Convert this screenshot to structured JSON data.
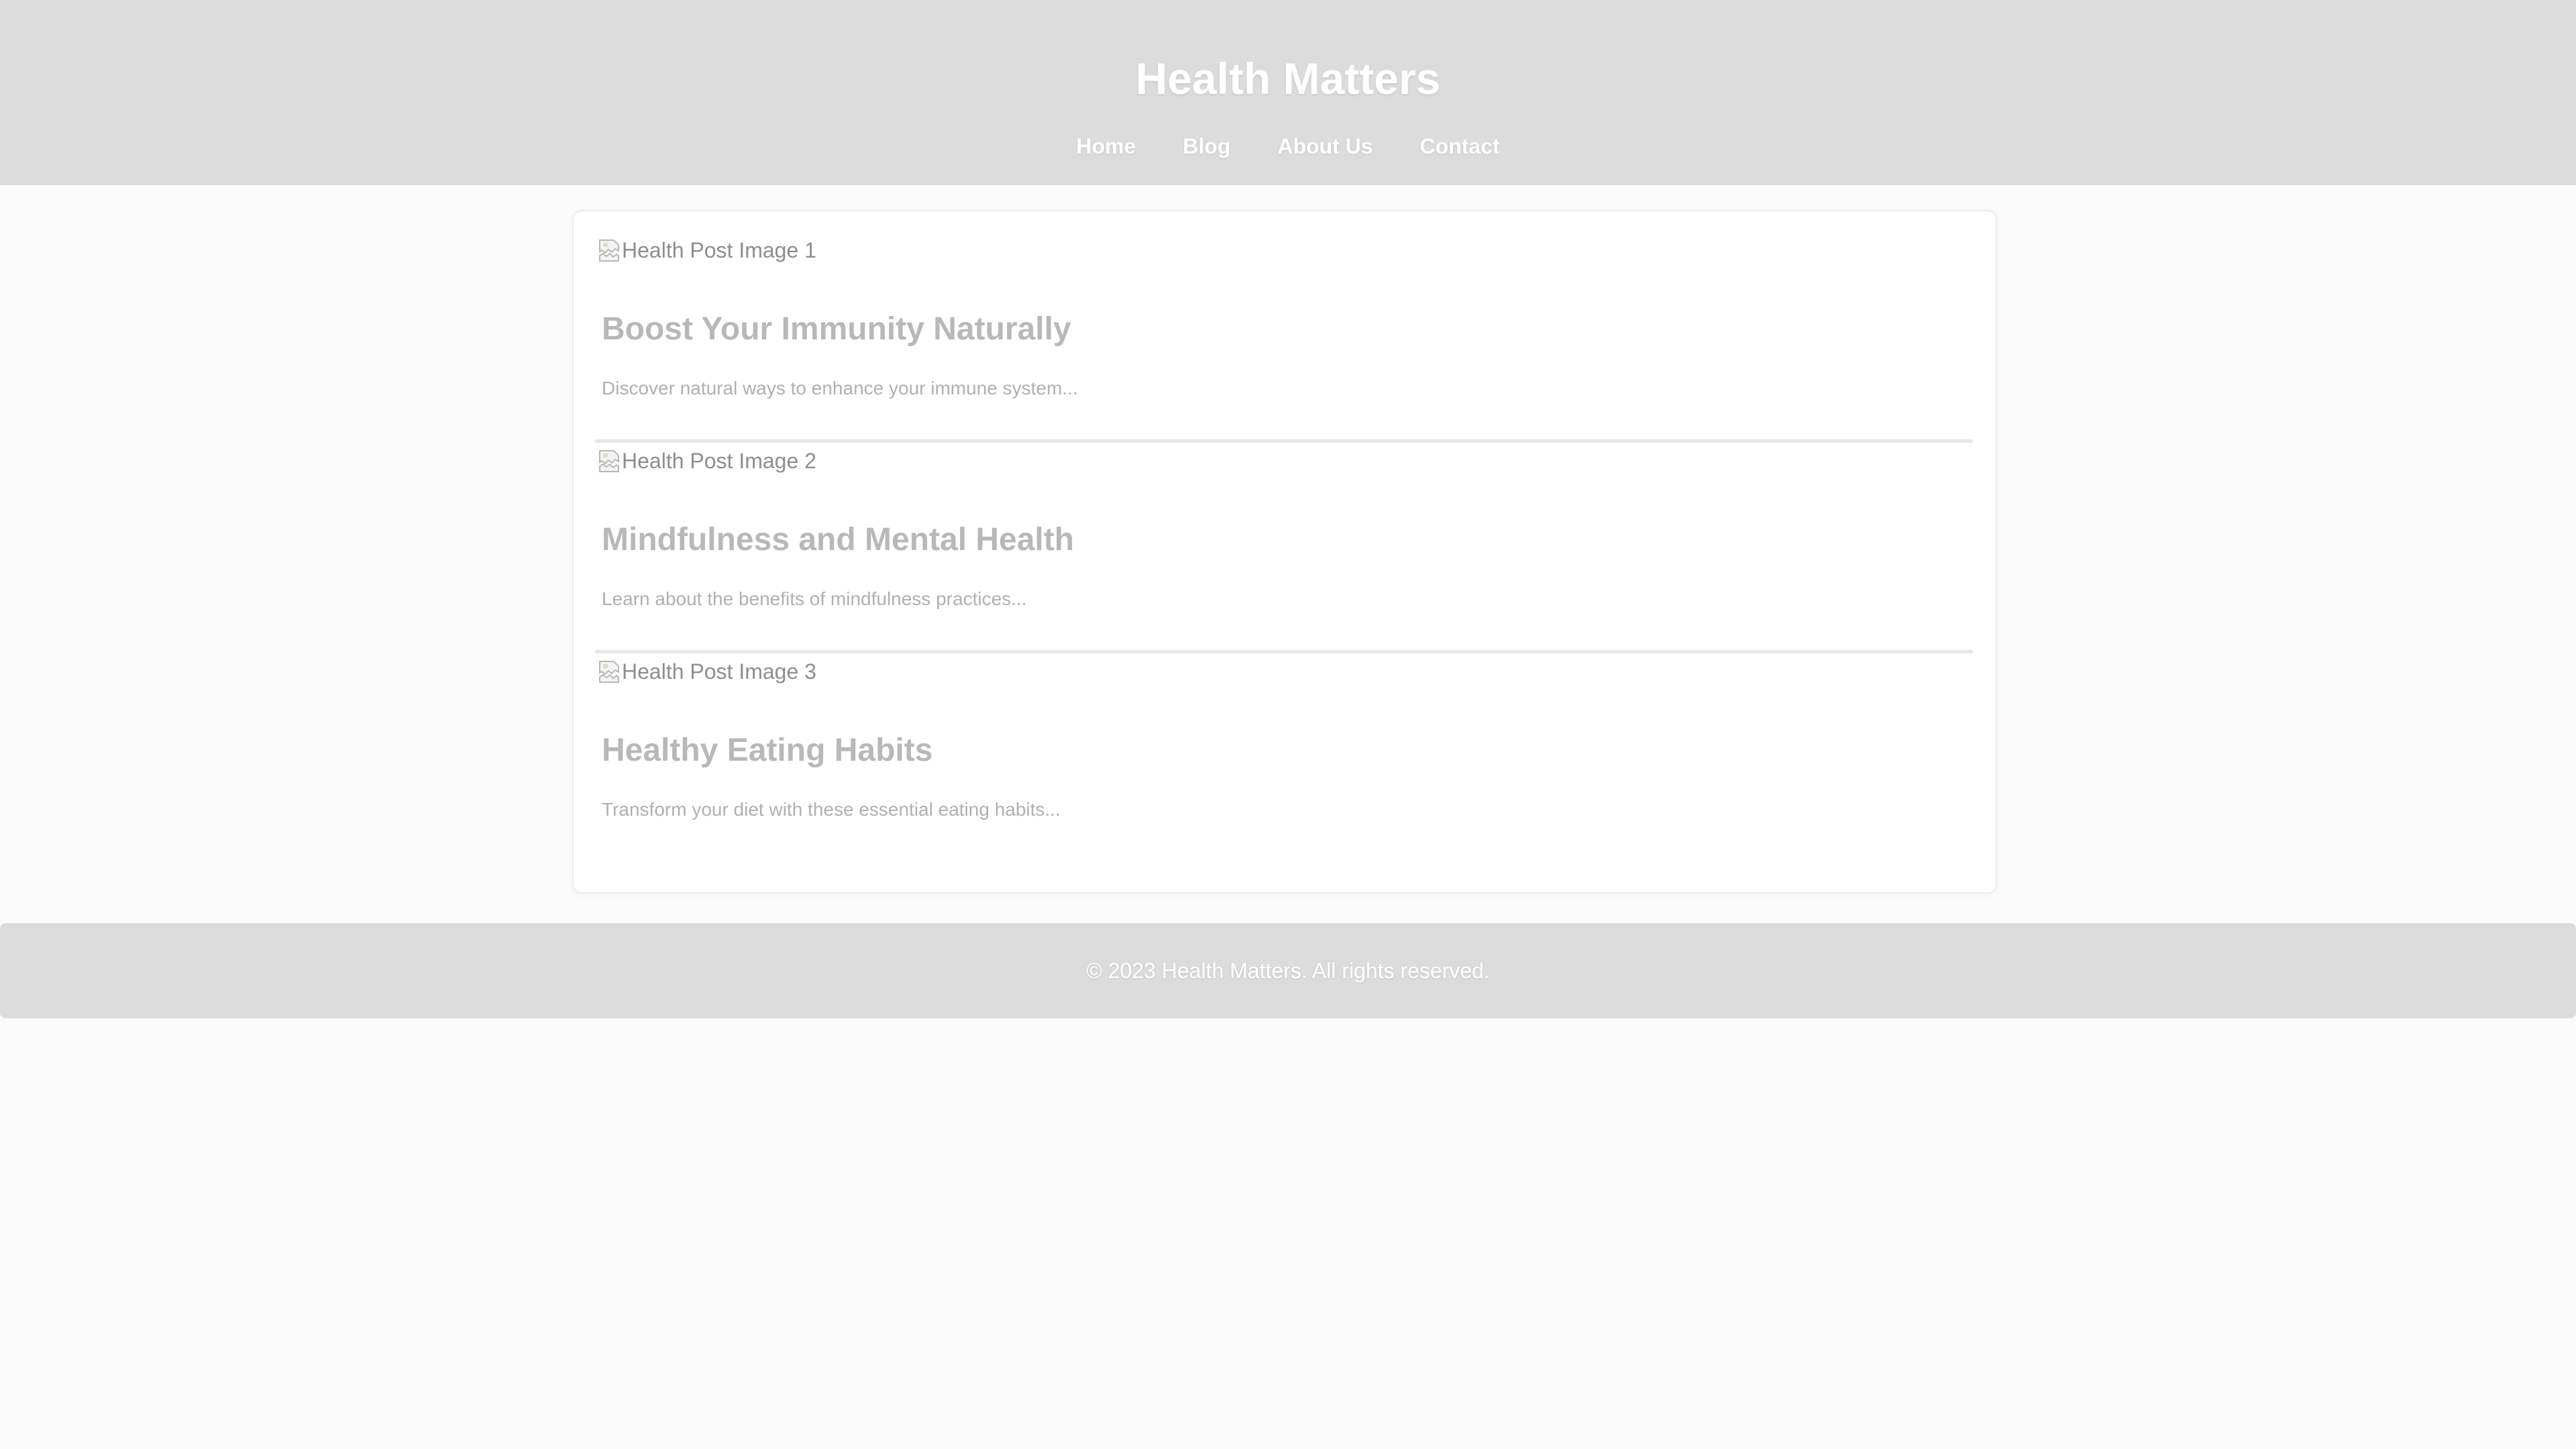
{
  "header": {
    "title": "Health Matters",
    "nav": [
      {
        "label": "Home"
      },
      {
        "label": "Blog"
      },
      {
        "label": "About Us"
      },
      {
        "label": "Contact"
      }
    ]
  },
  "posts": [
    {
      "image_alt": "Health Post Image 1",
      "title": "Boost Your Immunity Naturally",
      "excerpt": "Discover natural ways to enhance your immune system..."
    },
    {
      "image_alt": "Health Post Image 2",
      "title": "Mindfulness and Mental Health",
      "excerpt": "Learn about the benefits of mindfulness practices..."
    },
    {
      "image_alt": "Health Post Image 3",
      "title": "Healthy Eating Habits",
      "excerpt": "Transform your diet with these essential eating habits..."
    }
  ],
  "footer": {
    "copyright": "© 2023 Health Matters. All rights reserved."
  },
  "colors": {
    "header_bg": "#dcdcdc",
    "page_bg": "#fbfbfb",
    "card_bg": "#ffffff",
    "title_text": "#b8b8b8",
    "excerpt_text": "#b0b0b0",
    "header_text": "#ffffff"
  },
  "icons": {
    "post_image": "broken-image-icon"
  }
}
